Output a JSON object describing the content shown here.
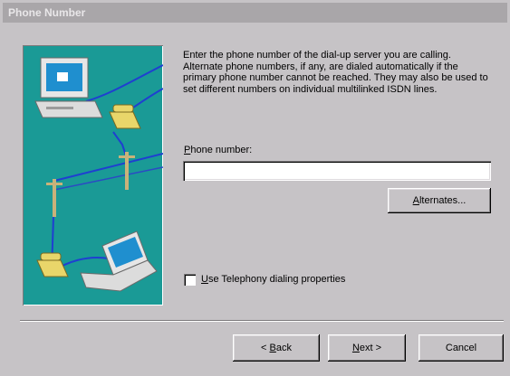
{
  "window": {
    "title": "Phone Number"
  },
  "instructions": "Enter the phone number of the dial-up server you are calling.  Alternate phone numbers, if any, are dialed automatically if the primary phone number cannot be reached.  They may also be used to set different numbers on individual multilinked ISDN lines.",
  "phone": {
    "label_accel": "P",
    "label_rest": "hone number:",
    "value": "",
    "placeholder": ""
  },
  "buttons": {
    "alternates_accel": "A",
    "alternates_rest": "lternates...",
    "back_prefix": "< ",
    "back_accel": "B",
    "back_rest": "ack",
    "next_accel": "N",
    "next_rest": "ext >",
    "cancel": "Cancel"
  },
  "telephony": {
    "accel": "U",
    "rest": "se Telephony dialing properties",
    "checked": false
  },
  "colors": {
    "dialog_bg": "#c6c3c6",
    "illustration_bg": "#1a9a96",
    "titlebar_bg": "#a9a6a9"
  },
  "icons": {
    "illustration": "dialup-network-illustration"
  }
}
